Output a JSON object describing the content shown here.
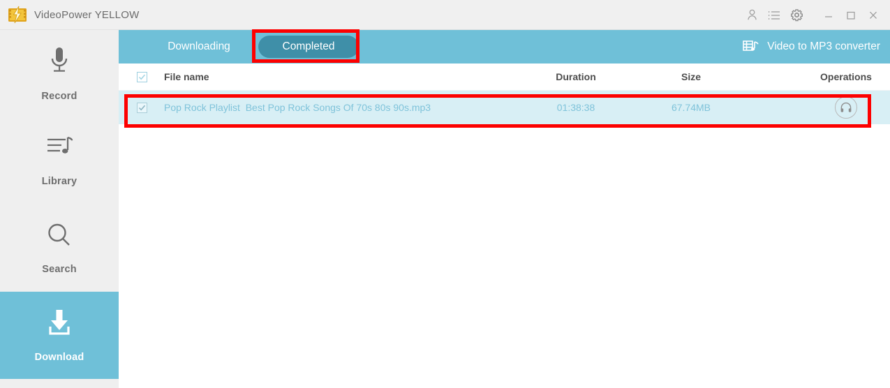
{
  "window": {
    "app_title": "VideoPower YELLOW",
    "logo_icon": "videopower-logo-icon",
    "controls": [
      {
        "name": "account-icon",
        "label": "account"
      },
      {
        "name": "list-icon",
        "label": "list"
      },
      {
        "name": "settings-gear-icon",
        "label": "settings"
      },
      {
        "name": "minimize-icon",
        "label": "minimize"
      },
      {
        "name": "maximize-icon",
        "label": "maximize"
      },
      {
        "name": "close-icon",
        "label": "close"
      }
    ]
  },
  "sidebar": {
    "items": [
      {
        "label": "Record",
        "icon": "microphone-icon",
        "active": false
      },
      {
        "label": "Library",
        "icon": "playlist-music-icon",
        "active": false
      },
      {
        "label": "Search",
        "icon": "magnifier-icon",
        "active": false
      },
      {
        "label": "Download",
        "icon": "download-arrow-icon",
        "active": true
      }
    ]
  },
  "tabs": {
    "downloading": "Downloading",
    "completed": "Completed",
    "selected": "Completed"
  },
  "converter": {
    "label": "Video to MP3 converter",
    "icon": "video-to-mp3-icon"
  },
  "table": {
    "headers": {
      "file_name": "File name",
      "duration": "Duration",
      "size": "Size",
      "operations": "Operations"
    },
    "select_all_checked": true,
    "rows": [
      {
        "checked": true,
        "file_name": "Pop Rock Playlist  Best Pop Rock Songs Of 70s 80s 90s.mp3",
        "duration": "01:38:38",
        "size": "67.74MB",
        "operation_icon": "headphones-icon"
      }
    ]
  },
  "colors": {
    "accent_teal": "#6fc0d8",
    "tab_selected": "#3f8fa8",
    "row_highlight": "#d8eff5",
    "annotation_red": "#fd0000",
    "row_text": "#7fc3da"
  }
}
